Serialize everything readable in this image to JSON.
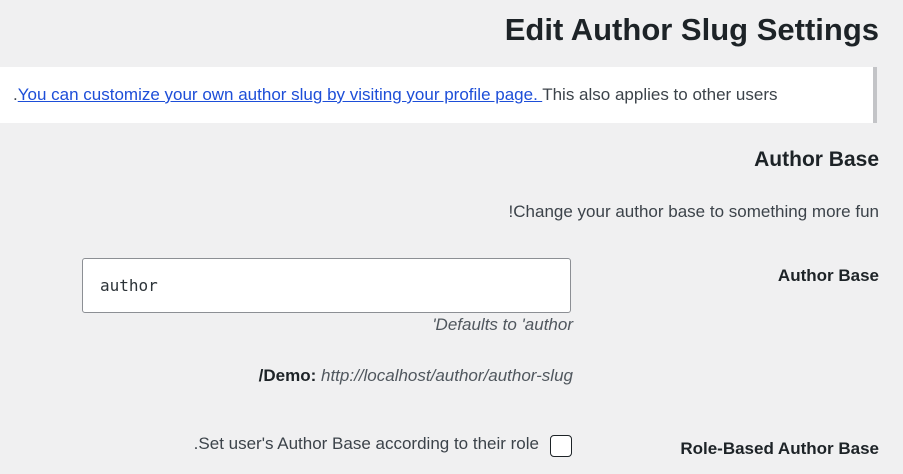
{
  "page": {
    "title": "Edit Author Slug Settings"
  },
  "notice": {
    "prefix": ".",
    "link_text": "You can customize your own author slug by visiting your profile page. ",
    "suffix": "This also applies to other users"
  },
  "author_base_section": {
    "title": "Author Base",
    "description": "!Change your author base to something more fun",
    "field_label": "Author Base",
    "input_value": "author",
    "default_hint": "'Defaults to 'author",
    "demo_label": "/Demo:",
    "demo_url": "http://localhost/author/author-slug"
  },
  "role_based": {
    "label": "Role-Based Author Base",
    "checkbox_text": ".Set user's Author Base according to their role",
    "checked": false
  }
}
